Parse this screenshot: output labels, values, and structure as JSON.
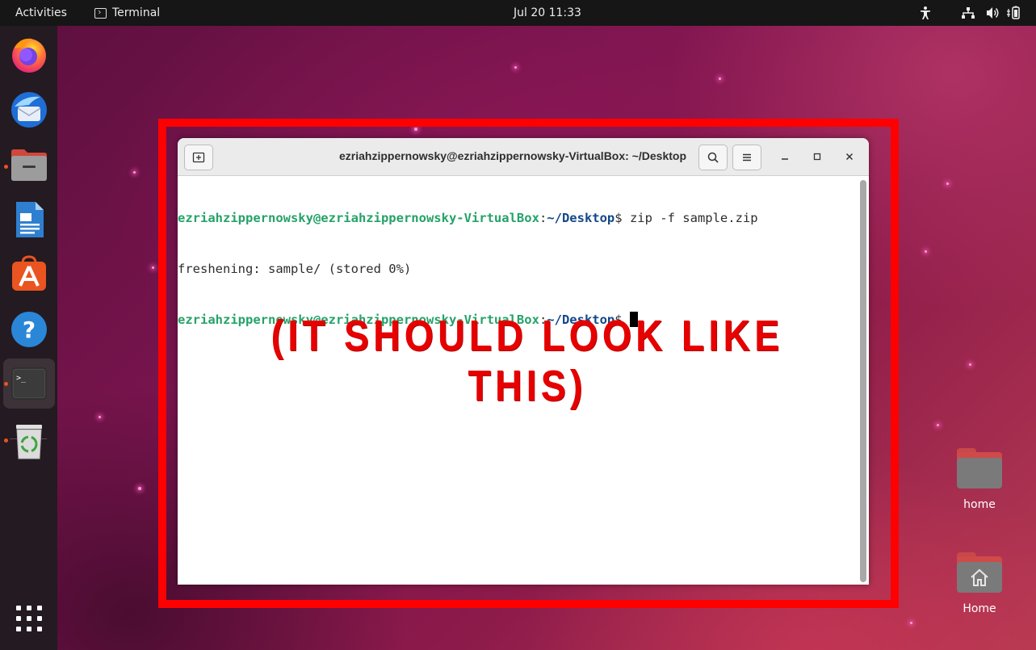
{
  "topbar": {
    "activities": "Activities",
    "app_name": "Terminal",
    "clock": "Jul 20  11:33",
    "tray_icons": [
      "accessibility-icon",
      "network-icon",
      "volume-icon",
      "battery-icon"
    ]
  },
  "dock": {
    "items": [
      {
        "name": "firefox",
        "icon": "firefox-icon",
        "running": false
      },
      {
        "name": "thunderbird",
        "icon": "thunderbird-icon",
        "running": false
      },
      {
        "name": "files",
        "icon": "files-icon",
        "running": true
      },
      {
        "name": "libreoffice-writer",
        "icon": "writer-icon",
        "running": false
      },
      {
        "name": "app-center",
        "icon": "app-center-icon",
        "running": false
      },
      {
        "name": "help",
        "icon": "help-icon",
        "running": false
      },
      {
        "name": "terminal",
        "icon": "terminal-icon",
        "running": true,
        "active": true
      },
      {
        "name": "trash",
        "icon": "trash-icon",
        "running": true
      }
    ],
    "show_apps_icon": "grid-icon"
  },
  "desktop": {
    "icons": [
      {
        "label": "home",
        "icon": "folder-icon"
      },
      {
        "label": "Home",
        "icon": "home-folder-icon"
      }
    ]
  },
  "terminal": {
    "title": "ezriahzippernowsky@ezriahzippernowsky-VirtualBox: ~/Desktop",
    "lines": [
      {
        "user_host": "ezriahzippernowsky@ezriahzippernowsky-VirtualBox",
        "sep": ":",
        "path": "~/Desktop",
        "prompt": "$ ",
        "command": "zip -f sample.zip"
      },
      {
        "output": "freshening: sample/ (stored 0%)"
      },
      {
        "user_host": "ezriahzippernowsky@ezriahzippernowsky-VirtualBox",
        "sep": ":",
        "path": "~/Desktop",
        "prompt": "$ ",
        "command": ""
      }
    ]
  },
  "annotation": {
    "text": "(IT SHOULD LOOK LIKE THIS)",
    "color": "#e60000",
    "frame_color": "#ff0000"
  },
  "colors": {
    "topbar_bg": "#161616",
    "dock_bg": "#241a21",
    "prompt_user": "#26a269",
    "prompt_path": "#12488b",
    "running_dot": "#e95420"
  }
}
